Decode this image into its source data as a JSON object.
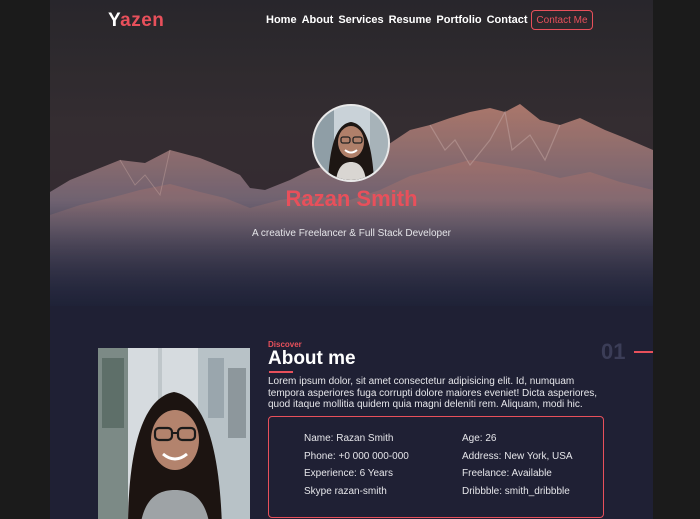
{
  "header": {
    "logo_first": "Y",
    "logo_rest": "azen",
    "nav": [
      "Home",
      "About",
      "Services",
      "Resume",
      "Portfolio",
      "Contact"
    ],
    "contact_button": "Contact Me"
  },
  "hero": {
    "name": "Razan Smith",
    "subtitle": "A creative Freelancer & Full Stack Developer"
  },
  "about": {
    "kicker": "Discover",
    "title": "About me",
    "section_number": "01",
    "text": "Lorem ipsum dolor, sit amet consectetur adipisicing elit. Id, numquam tempora asperiores fuga corrupti dolore maiores eveniet! Dicta asperiores, quod itaque mollitia quidem quia magni deleniti rem. Aliquam, modi hic.",
    "info_left": [
      "Name: Razan Smith",
      "Phone: +0 000 000-000",
      "Experience: 6 Years",
      "Skype razan-smith"
    ],
    "info_right": [
      "Age: 26",
      "Address: New York, USA",
      "Freelance: Available",
      "Dribbble: smith_dribbble"
    ]
  },
  "colors": {
    "accent": "#e8505b",
    "background": "#1f2034"
  }
}
